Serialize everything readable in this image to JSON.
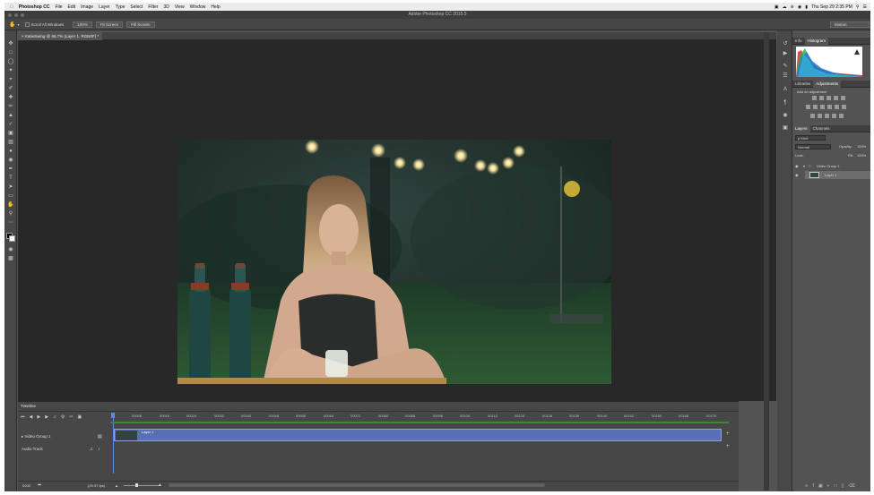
{
  "macmenu": {
    "app": "Photoshop CC",
    "items": [
      "File",
      "Edit",
      "Image",
      "Layer",
      "Type",
      "Select",
      "Filter",
      "3D",
      "View",
      "Window",
      "Help"
    ],
    "datetime": "Thu Sep 29  2:35 PM"
  },
  "window": {
    "title": "Adobe Photoshop CC 2015.5"
  },
  "options": {
    "scroll_all": "Scroll All Windows",
    "zoom": "100%",
    "fit_screen": "Fit Screen",
    "fill_screen": "Fill Screen",
    "workspace": "Motion"
  },
  "document": {
    "tab": "KatieSwing @ 66.7% (Layer 1, RGB/8*) *"
  },
  "panels": {
    "info_tab": "Info",
    "histogram_tab": "Histogram",
    "libraries_tab": "Libraries",
    "adjustments_tab": "Adjustments",
    "add_adjustment": "Add an adjustment",
    "layers_tab": "Layers",
    "channels_tab": "Channels",
    "kind": "ρ Kind",
    "blend": "Normal",
    "opacity_label": "Opacity:",
    "opacity": "100%",
    "lock_label": "Lock:",
    "fill_label": "Fill:",
    "fill": "100%",
    "layers": [
      {
        "name": "Video Group 1"
      },
      {
        "name": "Layer 1"
      }
    ]
  },
  "timeline": {
    "title": "Timeline",
    "ruler": [
      "00008",
      "00016",
      "00024",
      "00032",
      "00040",
      "00048",
      "00056",
      "00064",
      "00072",
      "00080",
      "00088",
      "00096",
      "00104",
      "00112",
      "00120",
      "00128",
      "00136",
      "00144",
      "00152",
      "00160",
      "00168",
      "00176"
    ],
    "tracks": [
      {
        "name": "Video Group 1"
      },
      {
        "name": "Audio Track"
      }
    ],
    "clip": "Layer 1",
    "timecode": "0000",
    "fps": "(29.97 fps)"
  },
  "colors": {
    "clip": "#5a6fb3",
    "histogram_bg": "#ffffff"
  }
}
